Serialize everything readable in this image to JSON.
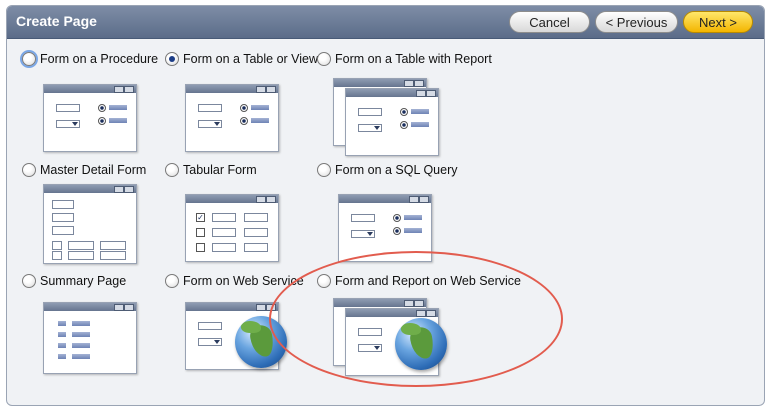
{
  "header": {
    "title": "Create Page",
    "cancel_label": "Cancel",
    "previous_label": "< Previous",
    "next_label": "Next >"
  },
  "options": [
    {
      "label": "Form on a Procedure",
      "selected": false
    },
    {
      "label": "Form on a Table or View",
      "selected": true
    },
    {
      "label": "Form on a Table with Report",
      "selected": false
    },
    {
      "label": "Master Detail Form",
      "selected": false
    },
    {
      "label": "Tabular Form",
      "selected": false
    },
    {
      "label": "Form on a SQL Query",
      "selected": false
    },
    {
      "label": "Summary Page",
      "selected": false
    },
    {
      "label": "Form on Web Service",
      "selected": false
    },
    {
      "label": "Form and Report on Web Service",
      "selected": false
    }
  ],
  "colors": {
    "header_bg": "#6b7a96",
    "next_button": "#f5c000",
    "highlight_ring": "#e25c4e",
    "radio_selected": "#1c3d86"
  },
  "icons": {
    "globe": "globe-icon",
    "form_thumbnail": "form-window-icon"
  }
}
